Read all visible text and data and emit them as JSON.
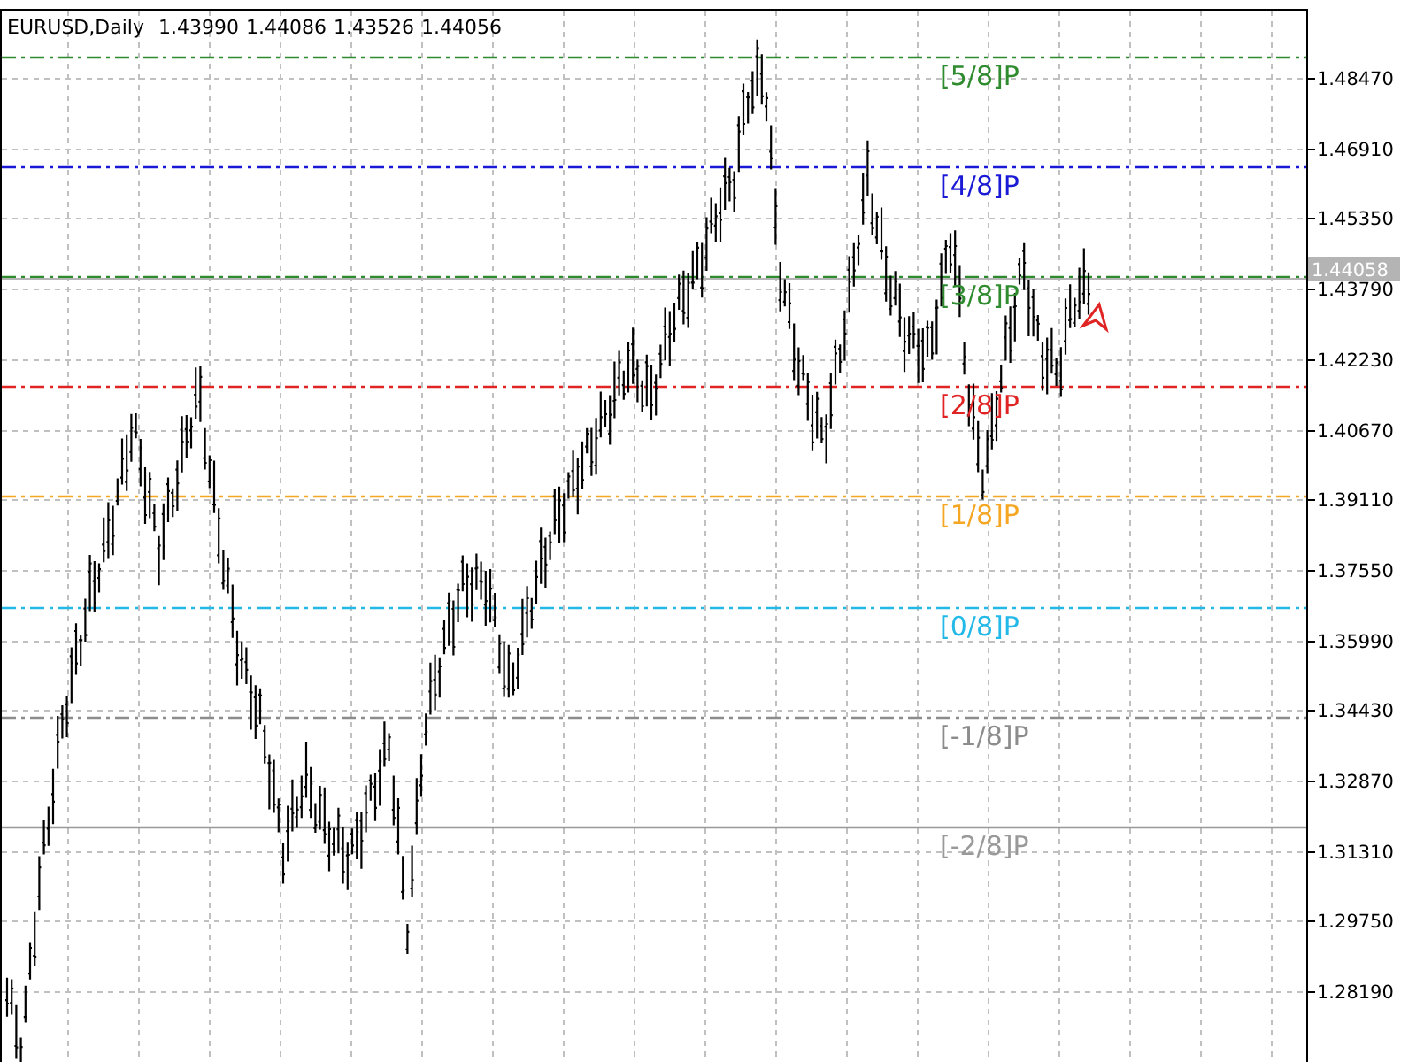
{
  "header": {
    "symbol": "EURUSD,Daily",
    "open": "1.43990",
    "high": "1.44086",
    "low": "1.43526",
    "close": "1.44056"
  },
  "price_axis": {
    "ticks": [
      "1.48470",
      "1.46910",
      "1.45350",
      "1.43790",
      "1.42230",
      "1.40670",
      "1.39110",
      "1.37550",
      "1.35990",
      "1.34430",
      "1.32870",
      "1.31310",
      "1.29750",
      "1.28190"
    ],
    "current_price": "1.44058"
  },
  "levels": [
    {
      "label": "[5/8]P",
      "color": "#2e8b2e",
      "kind": "dashdot"
    },
    {
      "label": "[4/8]P",
      "color": "#1a1ad6",
      "kind": "dashdot"
    },
    {
      "label": "[3/8]P",
      "color": "#2e8b2e",
      "kind": "dashdot"
    },
    {
      "label": "[2/8]P",
      "color": "#e02424",
      "kind": "dashdot"
    },
    {
      "label": "[1/8]P",
      "color": "#f5a623",
      "kind": "dashdot"
    },
    {
      "label": "[0/8]P",
      "color": "#22b8e8",
      "kind": "dashdot"
    },
    {
      "label": "[-1/8]P",
      "color": "#8c8c8c",
      "kind": "dashdot"
    },
    {
      "label": "[-2/8]P",
      "color": "#999999",
      "kind": "solid"
    }
  ]
}
